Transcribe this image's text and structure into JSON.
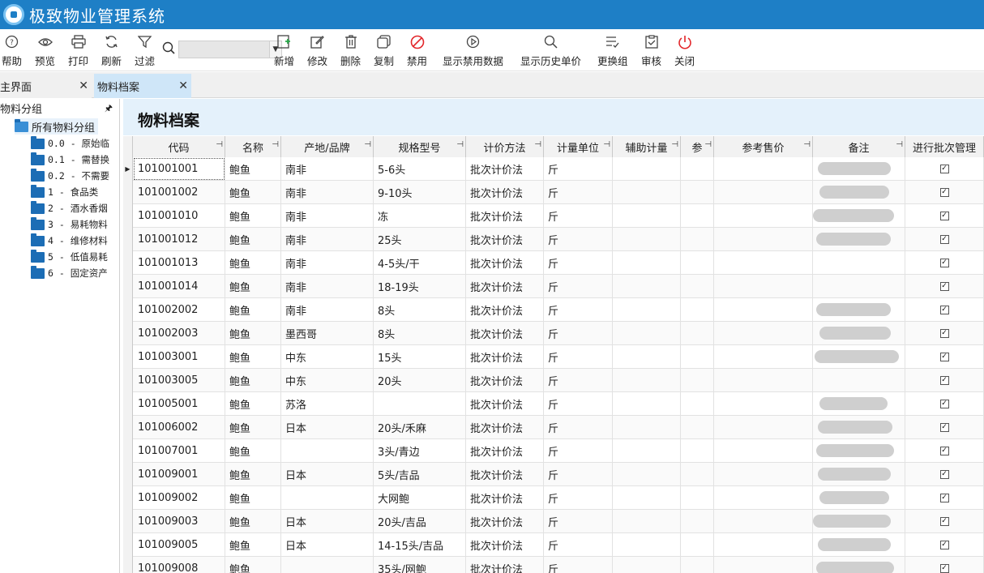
{
  "app": {
    "title": "极致物业管理系统"
  },
  "toolbar": {
    "help": "帮助",
    "preview": "预览",
    "print": "打印",
    "refresh": "刷新",
    "filter": "过滤",
    "add": "新增",
    "edit": "修改",
    "delete": "删除",
    "copy": "复制",
    "disable": "禁用",
    "show_disabled": "显示禁用数据",
    "show_history_price": "显示历史单价",
    "change_group": "更换组",
    "audit": "审核",
    "close": "关闭"
  },
  "tabs": {
    "home": "主界面",
    "active": "物料档案"
  },
  "left_panel": {
    "title": "物料分组",
    "root": "所有物料分组",
    "items": [
      "0.0 - 原始临",
      "0.1 - 需替换",
      "0.2 - 不需要",
      "1 - 食品类",
      "2 - 酒水香烟",
      "3 - 易耗物料",
      "4 - 维修材料",
      "5 - 低值易耗",
      "6 - 固定资产"
    ]
  },
  "main": {
    "title": "物料档案",
    "columns": [
      "代码",
      "名称",
      "产地/品牌",
      "规格型号",
      "计价方法",
      "计量单位",
      "辅助计量",
      "参",
      "参考售价",
      "备注",
      "进行批次管理"
    ],
    "rows": [
      {
        "code": "101001001",
        "name": "鲍鱼",
        "origin": "南非",
        "spec": "5-6头",
        "method": "批次计价法",
        "unit": "斤",
        "note": true
      },
      {
        "code": "101001002",
        "name": "鲍鱼",
        "origin": "南非",
        "spec": "9-10头",
        "method": "批次计价法",
        "unit": "斤",
        "note": true
      },
      {
        "code": "101001010",
        "name": "鲍鱼",
        "origin": "南非",
        "spec": "冻",
        "method": "批次计价法",
        "unit": "斤",
        "note": true
      },
      {
        "code": "101001012",
        "name": "鲍鱼",
        "origin": "南非",
        "spec": "25头",
        "method": "批次计价法",
        "unit": "斤",
        "note": true
      },
      {
        "code": "101001013",
        "name": "鲍鱼",
        "origin": "南非",
        "spec": "4-5头/干",
        "method": "批次计价法",
        "unit": "斤",
        "note": false
      },
      {
        "code": "101001014",
        "name": "鲍鱼",
        "origin": "南非",
        "spec": "18-19头",
        "method": "批次计价法",
        "unit": "斤",
        "note": false
      },
      {
        "code": "101002002",
        "name": "鲍鱼",
        "origin": "南非",
        "spec": "8头",
        "method": "批次计价法",
        "unit": "斤",
        "note": true
      },
      {
        "code": "101002003",
        "name": "鲍鱼",
        "origin": "墨西哥",
        "spec": "8头",
        "method": "批次计价法",
        "unit": "斤",
        "note": true
      },
      {
        "code": "101003001",
        "name": "鲍鱼",
        "origin": "中东",
        "spec": "15头",
        "method": "批次计价法",
        "unit": "斤",
        "note": true
      },
      {
        "code": "101003005",
        "name": "鲍鱼",
        "origin": "中东",
        "spec": "20头",
        "method": "批次计价法",
        "unit": "斤",
        "note": false
      },
      {
        "code": "101005001",
        "name": "鲍鱼",
        "origin": "苏洛",
        "spec": "",
        "method": "批次计价法",
        "unit": "斤",
        "note": true
      },
      {
        "code": "101006002",
        "name": "鲍鱼",
        "origin": "日本",
        "spec": "20头/禾麻",
        "method": "批次计价法",
        "unit": "斤",
        "note": true
      },
      {
        "code": "101007001",
        "name": "鲍鱼",
        "origin": "",
        "spec": "3头/青边",
        "method": "批次计价法",
        "unit": "斤",
        "note": true
      },
      {
        "code": "101009001",
        "name": "鲍鱼",
        "origin": "日本",
        "spec": "5头/吉品",
        "method": "批次计价法",
        "unit": "斤",
        "note": true
      },
      {
        "code": "101009002",
        "name": "鲍鱼",
        "origin": "",
        "spec": "大网鲍",
        "method": "批次计价法",
        "unit": "斤",
        "note": true
      },
      {
        "code": "101009003",
        "name": "鲍鱼",
        "origin": "日本",
        "spec": "20头/吉品",
        "method": "批次计价法",
        "unit": "斤",
        "note": true
      },
      {
        "code": "101009005",
        "name": "鲍鱼",
        "origin": "日本",
        "spec": "14-15头/吉品",
        "method": "批次计价法",
        "unit": "斤",
        "note": true
      },
      {
        "code": "101009008",
        "name": "鲍鱼",
        "origin": "",
        "spec": "35头/网鲍",
        "method": "批次计价法",
        "unit": "斤",
        "note": true
      }
    ]
  }
}
